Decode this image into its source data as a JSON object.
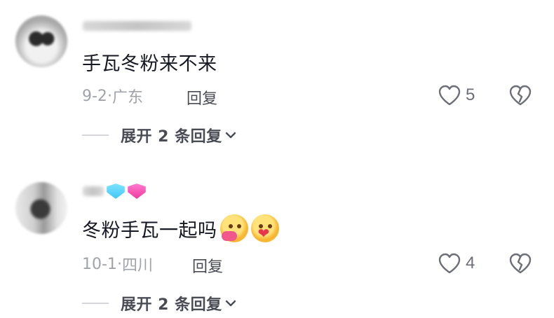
{
  "comments": [
    {
      "text": "手瓦冬粉来不来",
      "date": "9-2",
      "location": "广东",
      "reply_label": "回复",
      "like_count": "5",
      "expand_label": "展开 2 条回复"
    },
    {
      "text": "冬粉手瓦一起吗",
      "date": "10-1",
      "location": "四川",
      "reply_label": "回复",
      "like_count": "4",
      "expand_label": "展开 2 条回复",
      "emojis": [
        "hugging-face-emoji",
        "heart-face-emoji"
      ]
    }
  ],
  "colors": {
    "text_primary": "#161823",
    "text_secondary": "#a1a3ab",
    "action_text": "#4a4c55",
    "gem_blue": "#3ec7f5",
    "gem_pink": "#f03aa0"
  }
}
